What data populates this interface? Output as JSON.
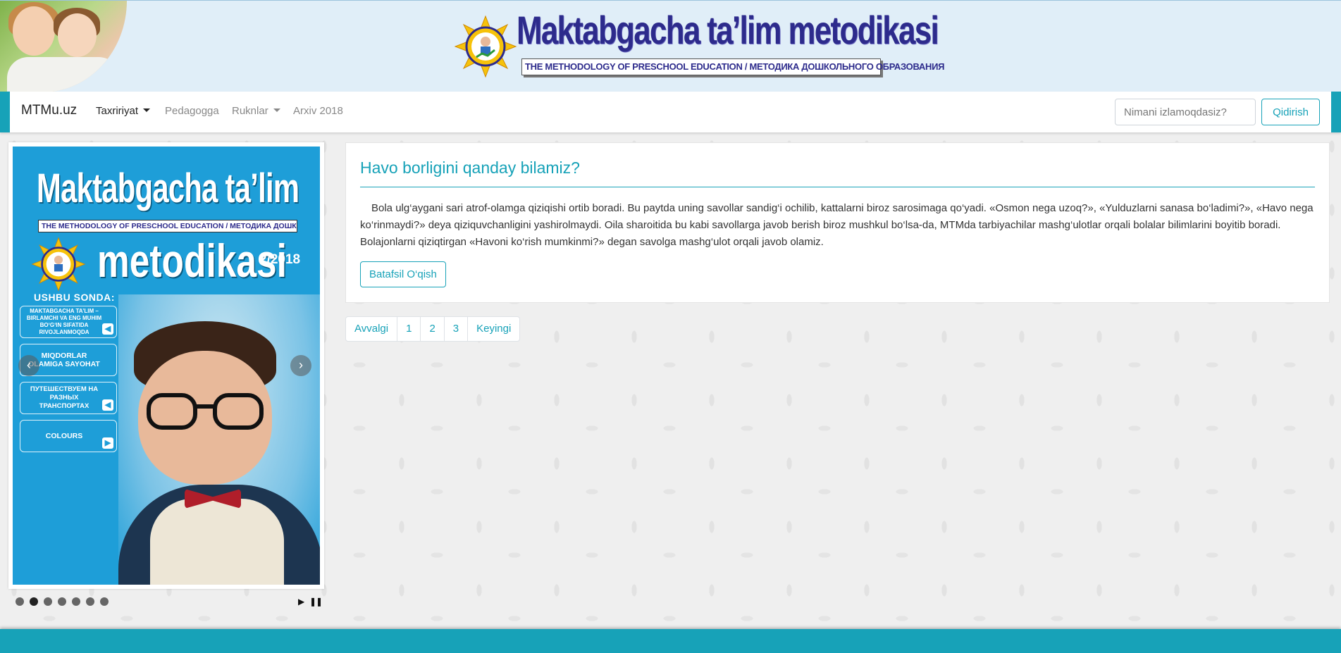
{
  "header": {
    "logo_title": "Maktabgacha ta’lim metodikasi",
    "logo_subtitle": "THE METHODOLOGY OF PRESCHOOL EDUCATION / МЕТОДИКА ДОШКОЛЬНОГО ОБРАЗОВАНИЯ"
  },
  "navbar": {
    "brand": "MTMu.uz",
    "items": [
      {
        "label": "Taxririyat",
        "dropdown": true,
        "active": true
      },
      {
        "label": "Pedagogga",
        "dropdown": false,
        "active": false
      },
      {
        "label": "Ruknlar",
        "dropdown": true,
        "active": false
      },
      {
        "label": "Arxiv 2018",
        "dropdown": false,
        "active": false
      }
    ],
    "search": {
      "placeholder": "Nimani izlamoqdasiz?",
      "value": "",
      "button_label": "Qidirish"
    }
  },
  "carousel": {
    "cover": {
      "title_line1": "Maktabgacha ta’lim",
      "bar_text": "THE METHODOLOGY OF PRESCHOOL EDUCATION / МЕТОДИКА ДОШКОЛЬНОГО ОБРАЗОВАНИЯ",
      "title_line2": "metodikasi",
      "issue": "2/2018",
      "section_heading": "USHBU SONDA:",
      "toc": [
        "MAKTABGACHA TA’LIM – BIRLAMCHI VA ENG MUHIM BO‘G‘IN SIFATIDA RIVOJLANMOQDA",
        "MIQDORLAR OLAMIGA SAYOHAT",
        "ПУТЕШЕСТВУЕМ НА РАЗНЫХ ТРАНСПОРТАХ",
        "COLOURS"
      ]
    },
    "prev_icon": "‹",
    "next_icon": "›",
    "slide_count": 7,
    "active_slide": 2,
    "play_icon": "▶",
    "pause_icon": "❚❚"
  },
  "article": {
    "title": "Havo borligini qanday bilamiz?",
    "body": "Bola ulg‘aygani sari atrof-olamga qiziqishi ortib boradi. Bu paytda uning savollar sandig‘i ochilib, kattalarni biroz sarosimaga qo‘yadi. «Osmon nega uzoq?», «Yulduzlarni sanasa bo‘ladimi?», «Havo nega ko‘rinmaydi?» deya qiziquvchanligini yashirolmaydi. Oila sharoitida bu kabi savollarga javob berish biroz mushkul bo‘lsa-da, MTMda tarbiyachilar mashg‘ulotlar orqali bolalar bilimlarini boyitib boradi. Bolajonlarni qiziqtirgan «Havoni ko‘rish mumkinmi?» degan savolga mashg‘ulot orqali javob olamiz.",
    "read_more_label": "Batafsil O‘qish"
  },
  "pagination": {
    "items": [
      "Avvalgi",
      "1",
      "2",
      "3",
      "Keyingi"
    ]
  },
  "colors": {
    "accent": "#17a2b8",
    "brand_blue": "#2d2b8c"
  }
}
